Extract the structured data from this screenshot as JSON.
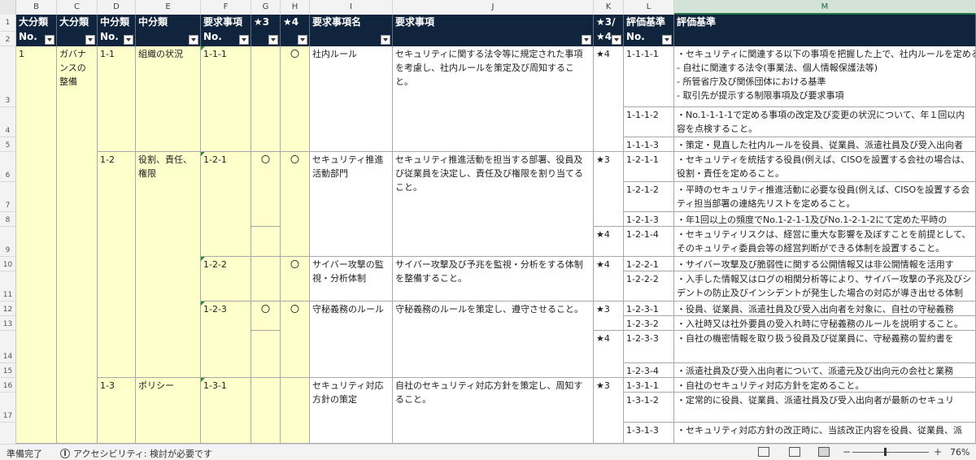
{
  "columns": [
    "B",
    "C",
    "D",
    "E",
    "F",
    "G",
    "H",
    "I",
    "J",
    "K",
    "L",
    "M"
  ],
  "header": {
    "b1": "大分類",
    "b2": "No.",
    "c1": "大分類",
    "d1": "中分類",
    "d2": "No.",
    "e1": "中分類",
    "f1": "要求事項",
    "f2": "No.",
    "g1": "★3",
    "h1": "★4",
    "i1": "要求事項名",
    "j1": "要求事項",
    "k1": "★3/",
    "k2": "★4",
    "l1": "評価基準",
    "l2": "No.",
    "m1": "評価基準"
  },
  "rows": {
    "b_1": "1",
    "c_1": "ガバナンスの整備",
    "d_1": "1-1",
    "e_1": "組織の状況",
    "f_1": "1-1-1",
    "h_1": "〇",
    "i_1": "社内ルール",
    "j_1": "セキュリティに関する法令等に規定された事項を考慮し、社内ルールを策定及び周知すること。",
    "k_1": "★4",
    "l_1": "1-1-1-1",
    "m_1a": "・セキュリティに関連する以下の事項を把握した上で、社内ルールを定める",
    "m_1b": "- 自社に関連する法令(事業法、個人情報保護法等)",
    "m_1c": "- 所管省庁及び関係団体における基準",
    "m_1d": "- 取引先が提示する制限事項及び要求事項",
    "l_2": "1-1-1-2",
    "m_2": "・No.1-1-1-1で定める事項の改定及び変更の状況について、年１回以内容を点検すること。",
    "l_3": "1-1-1-3",
    "m_3": "・策定・見直した社内ルールを役員、従業員、派遣社員及び受入出向者",
    "d_2": "1-2",
    "e_2": "役割、責任、権限",
    "f_2": "1-2-1",
    "g_2": "〇",
    "h_2": "〇",
    "i_2": "セキュリティ推進活動部門",
    "j_2": "セキュリティ推進活動を担当する部署、役員及び従業員を決定し、責任及び権限を割り当てること。",
    "k_2": "★3",
    "l_4": "1-2-1-1",
    "m_4": "・セキュリティを統括する役員(例えば、CISOを設置する会社の場合は、役割・責任を定めること。",
    "l_5": "1-2-1-2",
    "m_5": "・平時のセキュリティ推進活動に必要な役員(例えば、CISOを設置する会ティ担当部署の連絡先リストを定めること。",
    "l_6": "1-2-1-3",
    "m_6": "・年1回以上の頻度でNo.1-2-1-1及びNo.1-2-1-2にて定めた平時の",
    "k_3": "★4",
    "l_7": "1-2-1-4",
    "m_7": "・セキュリティリスクは、経営に重大な影響を及ぼすことを前提として、そのキュリティ委員会等の経営判断ができる体制を設置すること。",
    "f_3": "1-2-2",
    "h_3": "〇",
    "i_3": "サイバー攻撃の監視・分析体制",
    "j_3": "サイバー攻撃及び予兆を監視・分析をする体制を整備すること。",
    "k_4": "★4",
    "l_8": "1-2-2-1",
    "m_8": "・サイバー攻撃及び脆弱性に関する公開情報又は非公開情報を活用す",
    "l_9": "1-2-2-2",
    "m_9": "・入手した情報又はログの相関分析等により、サイバー攻撃の予兆及びシデントの防止及びインシデントが発生した場合の対応が導き出せる体制",
    "f_4": "1-2-3",
    "g_4": "〇",
    "h_4": "〇",
    "i_4": "守秘義務のルール",
    "j_4": "守秘義務のルールを策定し、遵守させること。",
    "k_5": "★3",
    "l_10": "1-2-3-1",
    "m_10": "・役員、従業員、派遣社員及び受入出向者を対象に、自社の守秘義務",
    "l_11": "1-2-3-2",
    "m_11": "・入社時又は社外要員の受入れ時に守秘義務のルールを説明すること。",
    "k_6": "★4",
    "l_12": "1-2-3-3",
    "m_12": "・自社の機密情報を取り扱う役員及び従業員に、守秘義務の誓約書を",
    "l_13": "1-2-3-4",
    "m_13": "・派遣社員及び受入出向者について、派遣元及び出向元の会社と業務",
    "d_3": "1-3",
    "e_3": "ポリシー",
    "f_5": "1-3-1",
    "i_5": "セキュリティ対応方針の策定",
    "j_5": "自社のセキュリティ対応方針を策定し、周知すること。",
    "k_7": "★3",
    "l_14": "1-3-1-1",
    "m_14": "・自社のセキュリティ対応方針を定めること。",
    "l_15": "1-3-1-2",
    "m_15": "・定常的に役員、従業員、派遣社員及び受入出向者が最新のセキュリ",
    "l_16": "1-3-1-3",
    "m_16": "・セキュリティ対応方針の改正時に、当該改正内容を役員、従業員、派"
  },
  "row_numbers": [
    "1",
    "2",
    "3",
    "4",
    "5",
    "6",
    "7",
    "8",
    "9",
    "10",
    "11",
    "12",
    "13",
    "14",
    "15",
    "16",
    "17"
  ],
  "status": {
    "ready": "準備完了",
    "accessibility": "アクセシビリティ: 検討が必要です",
    "zoom": "76%",
    "minus": "−",
    "plus": "+"
  }
}
